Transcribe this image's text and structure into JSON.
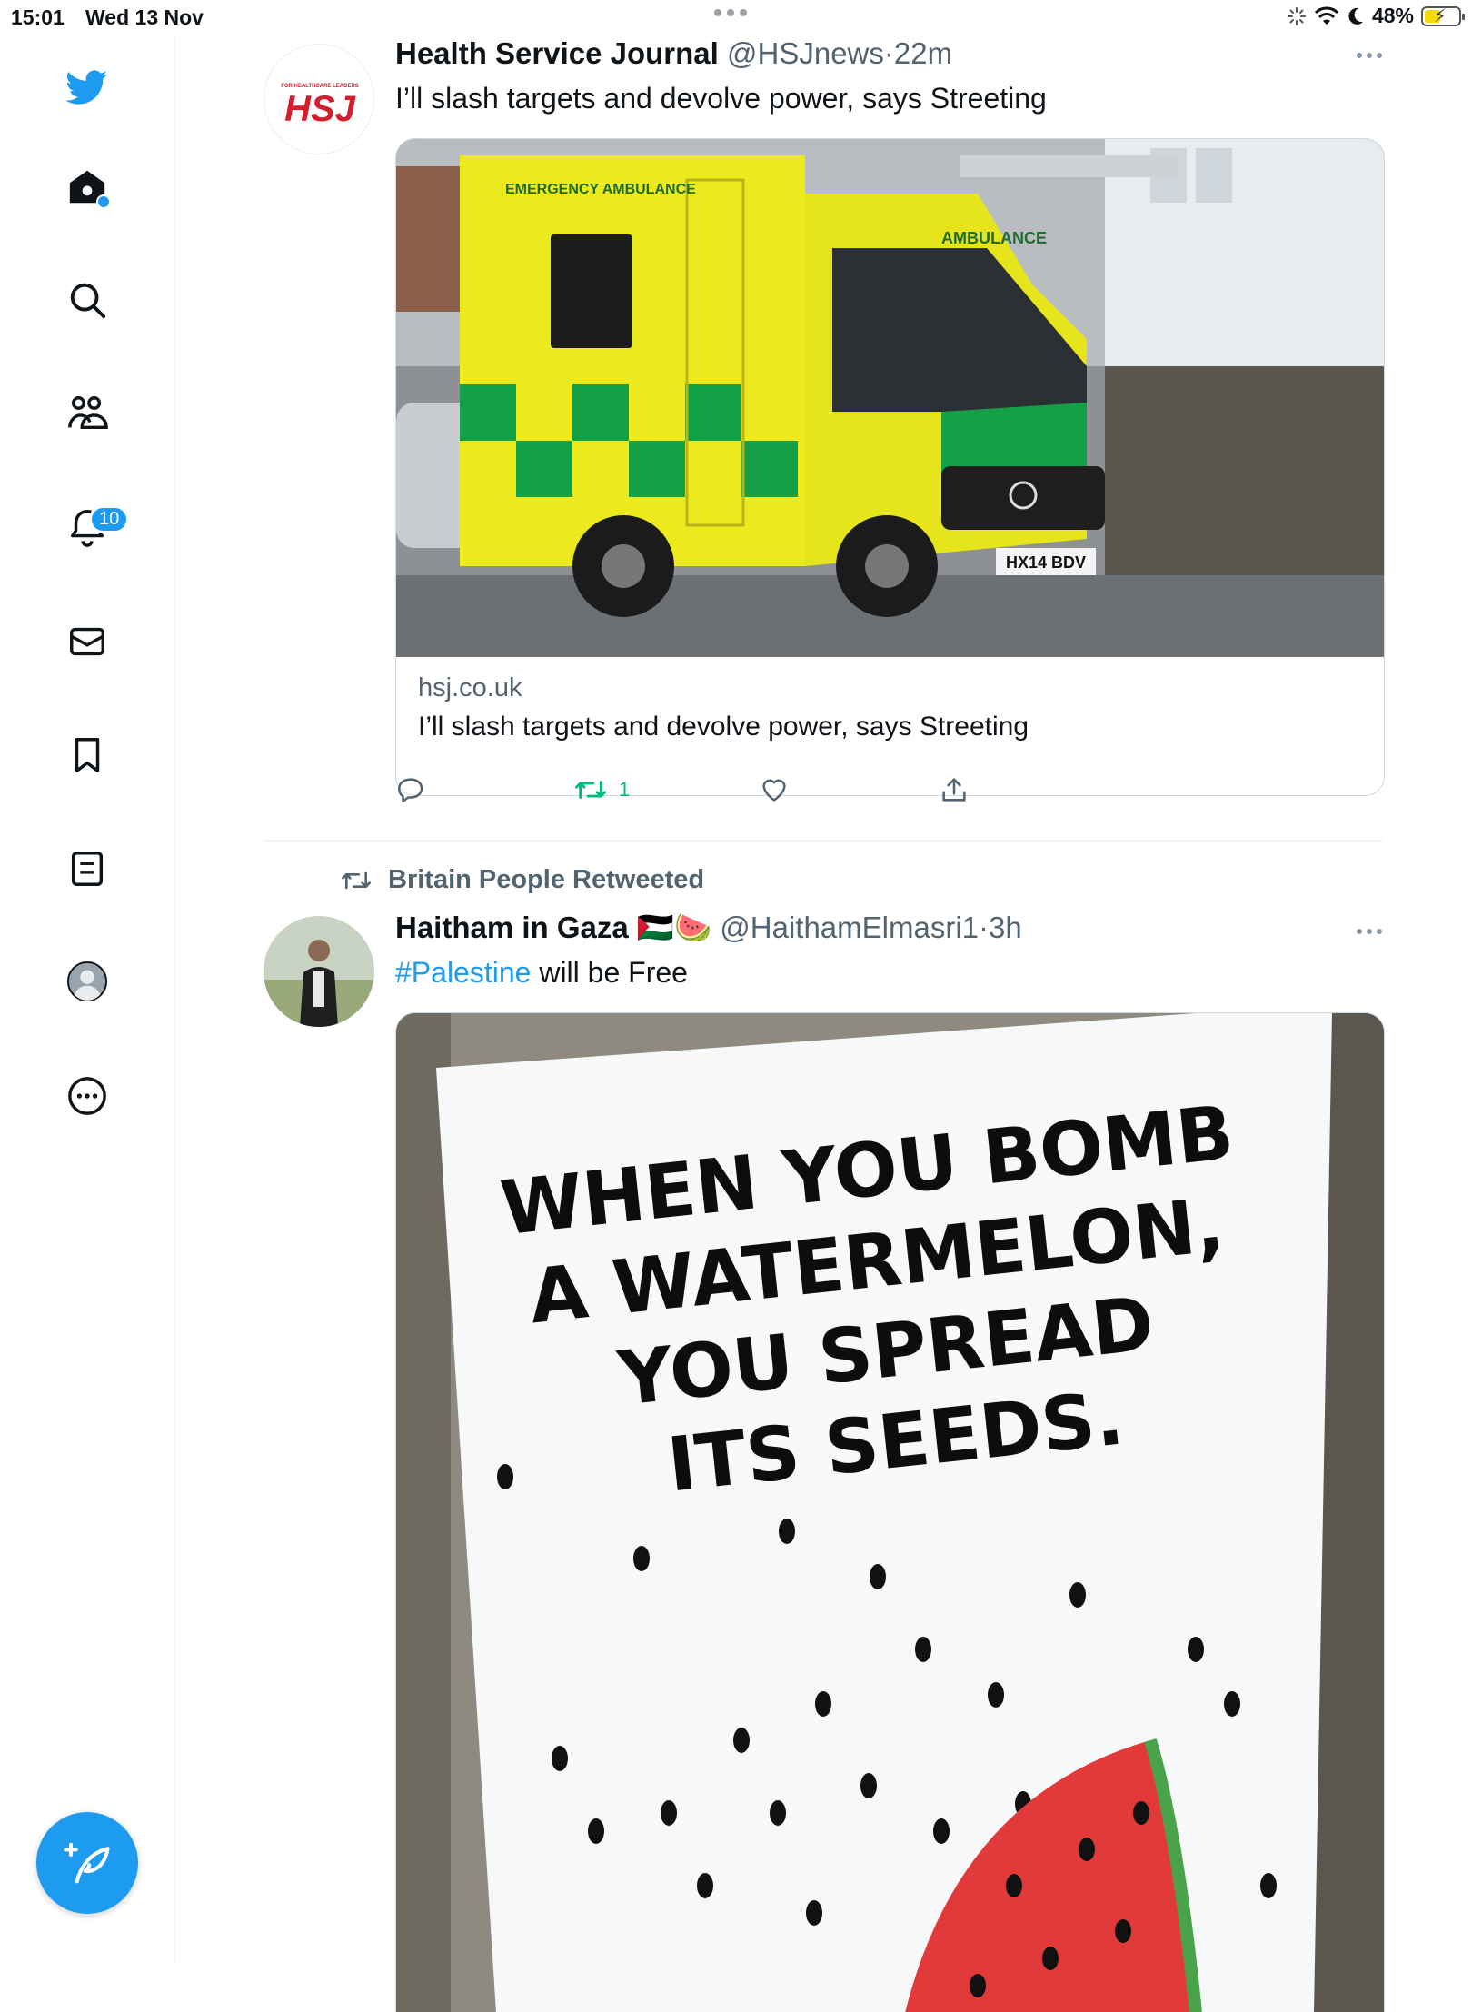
{
  "status_bar": {
    "time": "15:01",
    "date": "Wed 13 Nov",
    "battery": "48%",
    "battery_level": 0.48
  },
  "sidebar": {
    "items": [
      {
        "name": "home",
        "icon": "home-icon",
        "unread_dot": true
      },
      {
        "name": "explore",
        "icon": "search-icon"
      },
      {
        "name": "communities",
        "icon": "communities-icon"
      },
      {
        "name": "notifications",
        "icon": "bell-icon",
        "badge": "10"
      },
      {
        "name": "messages",
        "icon": "mail-icon"
      },
      {
        "name": "bookmarks",
        "icon": "bookmark-icon"
      },
      {
        "name": "lists",
        "icon": "list-icon"
      },
      {
        "name": "profile",
        "icon": "profile-avatar-icon"
      },
      {
        "name": "more",
        "icon": "more-circle-icon"
      }
    ],
    "compose_icon": "compose-feather-icon"
  },
  "colors": {
    "accent": "#1d9bf0",
    "retweet_green": "#00ba7c",
    "text_secondary": "#536471",
    "border": "#cfd9de"
  },
  "tweets": [
    {
      "author_name": "Health Service Journal",
      "handle": "@HSJnews",
      "separator": "·",
      "time": "22m",
      "text": "I’ll slash targets and devolve power, says Streeting",
      "avatar": {
        "logo": "HSJ",
        "tagline": "FOR HEALTHCARE LEADERS"
      },
      "card": {
        "image": {
          "van_side_label": "EMERGENCY AMBULANCE",
          "van_front_label": "AMBULANCE",
          "plate": "HX14 BDV"
        },
        "domain": "hsj.co.uk",
        "title": "I’ll slash targets and devolve power, says Streeting"
      },
      "actions": {
        "reply": "",
        "retweet": "1",
        "like": "",
        "share": ""
      }
    },
    {
      "social_context": "Britain People Retweeted",
      "author_name": "Haitham in Gaza",
      "name_emojis": "🇵🇸🍉",
      "handle": "@HaithamElmasri1",
      "separator": "·",
      "time": "3h",
      "hashtag": "#Palestine",
      "text_rest": " will be Free",
      "image": {
        "sign_lines": [
          "WHEN YOU BOMB",
          "A WATERMELON,",
          "YOU SPREAD",
          "ITS SEEDS."
        ]
      }
    }
  ]
}
